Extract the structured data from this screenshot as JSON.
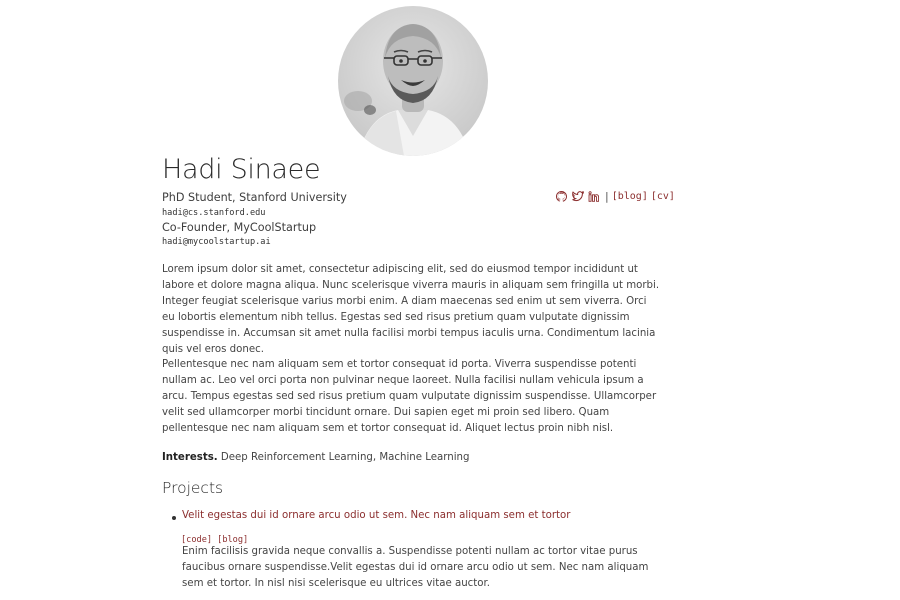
{
  "profile": {
    "name": "Hadi Sinaee",
    "affiliation_1": "PhD Student, Stanford University",
    "email_1": "hadi@cs.stanford.edu",
    "affiliation_2": "Co-Founder, MyCoolStartup",
    "email_2": "hadi@mycoolstartup.ai"
  },
  "links": {
    "github_icon": "github-icon",
    "twitter_icon": "twitter-icon",
    "linkedin_icon": "linkedin-icon",
    "separator": "|",
    "blog": "[blog]",
    "cv": "[cv]",
    "link_color": "#8b2e2e"
  },
  "bio": {
    "paragraph_1": "Lorem ipsum dolor sit amet, consectetur adipiscing elit, sed do eiusmod tempor incididunt ut labore et dolore magna aliqua. Nunc scelerisque viverra mauris in aliquam sem fringilla ut morbi. Integer feugiat scelerisque varius morbi enim. A diam maecenas sed enim ut sem viverra. Orci eu lobortis elementum nibh tellus. Egestas sed sed risus pretium quam vulputate dignissim suspendisse in. Accumsan sit amet nulla facilisi morbi tempus iaculis urna. Condimentum lacinia quis vel eros donec.",
    "paragraph_2": "Pellentesque nec nam aliquam sem et tortor consequat id porta. Viverra suspendisse potenti nullam ac. Leo vel orci porta non pulvinar neque laoreet. Nulla facilisi nullam vehicula ipsum a arcu. Tempus egestas sed sed risus pretium quam vulputate dignissim suspendisse. Ullamcorper velit sed ullamcorper morbi tincidunt ornare. Dui sapien eget mi proin sed libero. Quam pellentesque nec nam aliquam sem et tortor consequat id. Aliquet lectus proin nibh nisl."
  },
  "interests": {
    "label": "Interests.",
    "value": "Deep Reinforcement Learning, Machine Learning"
  },
  "projects": {
    "title": "Projects",
    "items": [
      {
        "title": "Velit egestas dui id ornare arcu odio ut sem. Nec nam aliquam sem et tortor",
        "code": "[code]",
        "blog": "[blog]",
        "description": "Enim facilisis gravida neque convallis a. Suspendisse potenti nullam ac tortor vitae purus faucibus ornare suspendisse.Velit egestas dui id ornare arcu odio ut sem. Nec nam aliquam sem et tortor. In nisl nisi scelerisque eu ultrices vitae auctor."
      }
    ]
  }
}
